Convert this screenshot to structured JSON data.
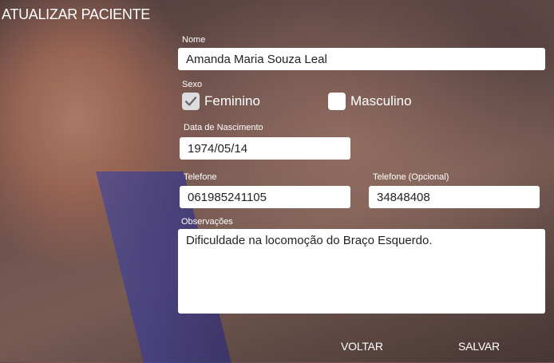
{
  "header": {
    "title": "ATUALIZAR PACIENTE"
  },
  "form": {
    "nome": {
      "label": "Nome",
      "value": "Amanda Maria Souza Leal"
    },
    "sexo": {
      "label": "Sexo",
      "options": [
        {
          "label": "Feminino",
          "checked": true
        },
        {
          "label": "Masculino",
          "checked": false
        }
      ]
    },
    "nascimento": {
      "label": "Data de Nascimento",
      "value": "1974/05/14"
    },
    "telefone": {
      "label": "Telefone",
      "value": "061985241105"
    },
    "telefone_opcional": {
      "label": "Telefone (Opcional)",
      "value": "34848408"
    },
    "observacoes": {
      "label": "Observações",
      "value": "Dificuldade na locomoção do Braço Esquerdo."
    }
  },
  "actions": {
    "back_label": "VOLTAR",
    "save_label": "SALVAR"
  },
  "colors": {
    "field_bg": "#ffffff",
    "text": "#ffffff",
    "band": "#4b489c"
  }
}
